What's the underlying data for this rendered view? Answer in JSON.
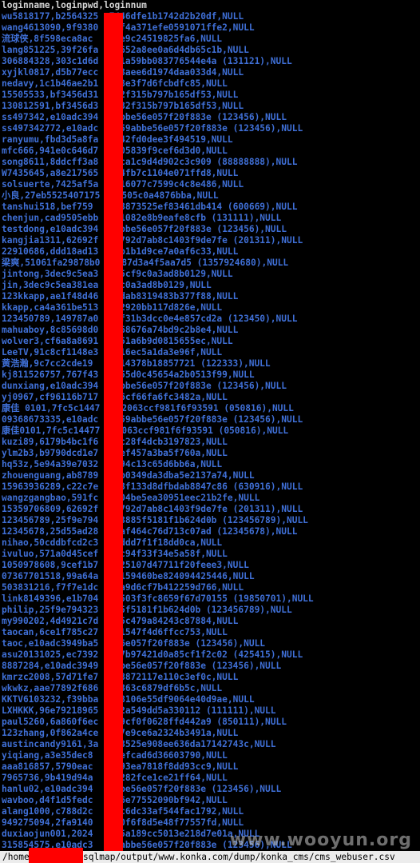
{
  "header": "loginname,loginpwd,loginnum",
  "rows": [
    "wu5818177,b2564325  7446dfe1b1742d2b20df,NULL",
    "wang4613090,9f9380  f6f4a371efe0591071ffe2,NULL",
    "流球侠,8f598eca8ac  c42e9c24519825fa6,NULL",
    "lang851225,39f26fa  9e652a8ee0a6d4db65c1b,NULL",
    "306884328,303c1d6d  b91a59bb083776544e4a (131121),NULL",
    "xyjkl0817,d5b77ecc  ed3aee6d1974daa033d4,NULL",
    "nedavy,1c1b46ae2b1  1c8e3f7d6fcbdfc85,NULL",
    "15505533,bf3456d31  632f315b797b165df53,NULL",
    "130812591,bf3456d3  6632f315b797b165df53,NULL",
    "ss497342,e10adc394  9abbe56e057f20f883e (123456),NULL",
    "ss497342772,e10adc  ba59abbe56e057f20f883e (123456),NULL",
    "ranyumu,fbd3d5a8fa  4742fd0dee3f494519,NULL",
    "mfc666,941e0c646d7  b705839f9cef6d3d0,NULL",
    "song8611,8ddcff3a8  89ca1c9d4d902c3c909 (88888888),NULL",
    "W7435645,a8e217565  664fb7c1104e071ffd8,NULL",
    "solsuerte,7425af5a  9616077c7599c4c8e486,NULL",
    "小良,27eb5525407175  b0505c0a4876bba,NULL",
    "tanshui518,bef759  8d53873525ef83461db414 (600669),NULL",
    "chenjun,cad9505ebb  1f1082e8b9eafe8cfb (131111),NULL",
    "testdong,e10adc394  9abbe56e057f20f883e (123456),NULL",
    "kangjia1311,62692f  f3792d7ab8c1403f9de7fe (201311),NULL",
    "22910686,ddd18ad13  12b1b1d9ce7a0af6c33,NULL",
    "梁爽,51061fa29878b0  7587d3a4f5aa7d5 (1357924680),NULL",
    "jintong,3dec9c5ea3  335cf9c0a3ad8b0129,NULL",
    "jin,3dec9c5ea381ea  f9c0a3ad8b0129,NULL",
    "123kkapp,ae1f48d46  71dab8319483b377f88,NULL",
    "kkapp,ca4a361be513  082920bb117d826e,NULL",
    "123450789,149787a0  86f31b3dcc0e4e857cd2a (123450),NULL",
    "mahuaboy,8c85698d0  8468676a74bd9c2b8e4,NULL",
    "wolver3,cf6a8a8691  a151a6b9d0815655ec,NULL",
    "LeeTV,91c8cf1148e3  aa16ec5a1da3e96f,NULL",
    "黄浩瀚,9c7cc2cde19  6d314378b18857721 (122333),NULL",
    "kj811526757,767f43  9055d0c45654a2b0513f99,NULL",
    "dunxiang,e10adc394  9abbe56e057f20f883e (123456),NULL",
    "yj0967,cf96116b717  d36cf66fa6fc3482a,NULL",
    "康佳 0101,7fc5c1447  de2063ccf981f6f93591 (050816),NULL",
    "09368673335,e10adc  ba59abbe56e057f20f883e (123456),NULL",
    "康佳0101,7fc5c14477  e2063ccf981f6f93591 (050816),NULL",
    "kuzi89,6179b4bc1f6  23c28f4dcb3197823,NULL",
    "ylm2b3,b9790dcd1e7  62ef457a3ba5f760a,NULL",
    "hq53z,5e94a39e7032  8094c13c65d6bb6a,NULL",
    "zhouenguang,ab8789  7eb0349da3dba5e2137a74,NULL",
    "15963936289,c22c7e  533f133d8dfbdab8847c86 (630916),NULL",
    "wangzgangbao,591fc  4e04be5ea30951eec21b2fe,NULL",
    "15359706809,62692f  f3792d7ab8c1403f9de7fe (201311),NULL",
    "123456789,25f9e794  453885f5181f1b624d0b (123456789),NULL",
    "12345678,25d55ad28  00af464c76d713c07ad (12345678),NULL",
    "nihao,50cddbfcd2c3  49ddd7f1f18dd0ca,NULL",
    "ivuluo,571a0d45cef  dec94f33f34e5a58f,NULL",
    "1050978608,9cef1b7  e725107d47711f20feee3,NULL",
    "07367701518,99a64a  bd159460be824094425446,NULL",
    "503831216,f7f7e1dc  d0a9d6cf7b412259d766,NULL",
    "link8149396,e1b704  b4503f3fc8659f67d70155 (19850701),NULL",
    "philip,25f9e794323  885f5181f1b624d0b (123456789),NULL",
    "my990202,4d4921c7d  1a5c479a84243c87884,NULL",
    "taocan,6ce1f785c27  3f1547f4d6ffcc753,NULL",
    "taoc,e10adc3949ba5  e56e057f20f883e (123456),NULL",
    "asu20131025,ec7392  627b97421d0a85cf1f2c02 (425415),NULL",
    "8887284,e10adc3949  abbe56e057f20f883e (123456),NULL",
    "kmrzc2008,57d71fe7  f78872117e110c3ef0c,NULL",
    "wkwkz,aae77892f686  54363c6879df6b5c,NULL",
    "KKTV6103232,f39bba  328106e55df9064e40d9ae,NULL",
    "LXHKKK,96e79218965  c92a549dd5a330112 (111111),NULL",
    "paul5260,6a860f6ec  729cf0f0628ffd442a9 (850111),NULL",
    "123zhang,0f862a4ce  6d7e9ce6a2324b3491a,NULL",
    "austincandy9161,3a  813525e908ee636da17142743c,NULL",
    "yiqiang,a3e35dec8  b92efcad6d36603790,NULL",
    "aaa816857,5790eac  7e793ea7818f8dd93cc9,NULL",
    "7965736,9b419d94a  cc9282fce1ce21ff64,NULL",
    "hanlu02,e10adc394  9abbe56e057f20f883e (123456),NULL",
    "wavboo,d4f1d5fedc  a936e77552090bf942,NULL",
    "alang1000,c788d2c  d36c6dc33af544fac1792,NULL",
    "949275094,2fa9140  dac0f6f8d5e48f77557fd,NULL",
    "duxiaojun001,2024  7c25a189cc5013e218d7e01a,NULL",
    "315854575,e10adc3  a59abbe56e057f20f883e (123456),NULL"
  ],
  "statusbar": "/home         .sqlmap/output/www.konka.com/dump/konka_cms/cms_webuser.csv",
  "watermark": "www.wooyun.org",
  "colors": {
    "background": "#000000",
    "header_text": "#d6d6d6",
    "row_text": "#3f6fd6",
    "redaction": "#ff0000",
    "statusbar_bg": "#ececec"
  }
}
